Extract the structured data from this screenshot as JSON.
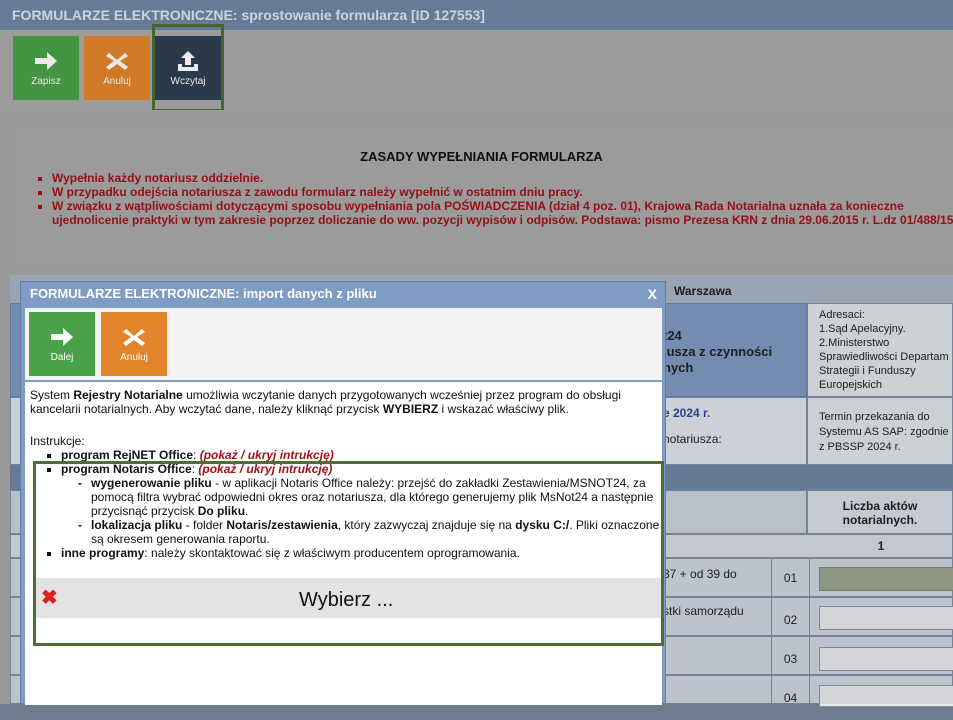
{
  "main": {
    "title": "FORMULARZE ELEKTRONICZNE: sprostowanie formularza [ID 127553]",
    "buttons": {
      "save": "Zapisz",
      "cancel": "Anuluj",
      "load": "Wczytaj"
    },
    "rules_title": "ZASADY WYPEŁNIANIA FORMULARZA",
    "rules": [
      "Wypełnia każdy notariusz oddzielnie.",
      "W przypadku odejścia notariusza z zawodu formularz należy wypełnić w ostatnim dniu pracy.",
      "W związku z wątpliwościami dotyczącymi sposobu wypełniania pola POŚWIADCZENIA (dział 4 poz. 01), Krajowa Rada Notarialna uznała za konieczne ujednolicenie praktyki w tym zakresie poprzez doliczanie do ww. pozycji wypisów i odpisów. Podstawa: pismo Prezesa KRN z dnia 29.06.2015 r. L.dz 01/488/15."
    ],
    "form": {
      "location": "Warszawa",
      "heading": [
        "t24",
        "iusza z czynności",
        "nych"
      ],
      "addressees": "Adresaci:\n1.Sąd Apelacyjny.\n2.Ministerstwo Sprawiedliwości Departam Strategii i Funduszy Europejskich",
      "year": "e 2024 r.",
      "notary_label": "notariusza:",
      "deadline": "Termin przekazania do Systemu AS SAP: zgodnie z PBSSP 2024 r.",
      "column_header": "Liczba aktów notarialnych.",
      "column_number": "1",
      "rows": [
        {
          "text": "37 + od 39 do",
          "code": "01"
        },
        {
          "text": "stki samorządu",
          "code": "02"
        },
        {
          "text": "",
          "code": "03"
        },
        {
          "text": "",
          "code": "04"
        }
      ]
    }
  },
  "dialog": {
    "title": "FORMULARZE ELEKTRONICZNE: import danych z pliku",
    "close": "X",
    "buttons": {
      "next": "Dalej",
      "cancel": "Anuluj"
    },
    "intro_1": "System ",
    "intro_bold_1": "Rejestry Notarialne",
    "intro_2": " umożliwia wczytanie danych przygotowanych wcześniej przez program do obsługi kancelarii notarialnych. Aby wczytać dane, należy kliknąć przycisk ",
    "intro_bold_2": "WYBIERZ",
    "intro_3": " i wskazać właściwy plik.",
    "instructions": "Instrukcje:",
    "items": {
      "rejnet": "program RejNET Office",
      "notaris": "program Notaris Office",
      "toggle": "(pokaż / ukryj intrukcję)",
      "gen_bold": "wygenerowanie pliku",
      "gen_text_1": " - w aplikacji Notaris Office należy: przejść do zakładki Zestawienia/MSNOT24, za pomocą filtra wybrać odpowiedni okres oraz notariusza, dla którego generujemy plik MsNot24 a następnie przycisnąć przycisk ",
      "gen_bold_2": "Do pliku",
      "gen_text_2": ".",
      "loc_bold": "lokalizacja pliku",
      "loc_text_1": " - folder ",
      "loc_bold_2": "Notaris/zestawienia",
      "loc_text_2": ", który zazwyczaj znajduje się na ",
      "loc_bold_3": "dysku C:/",
      "loc_text_3": ". Pliki oznaczone są okresem generowania raportu.",
      "other_bold": "inne programy",
      "other_text": ": należy skontaktować się z właściwym producentem oprogramowania."
    },
    "choose_button": "Wybierz ..."
  },
  "colors": {
    "green": "#4aa14a",
    "orange": "#e2842a",
    "dark": "#2f3f52",
    "highlight": "#4d6e35",
    "rule_red": "#a1121b"
  }
}
